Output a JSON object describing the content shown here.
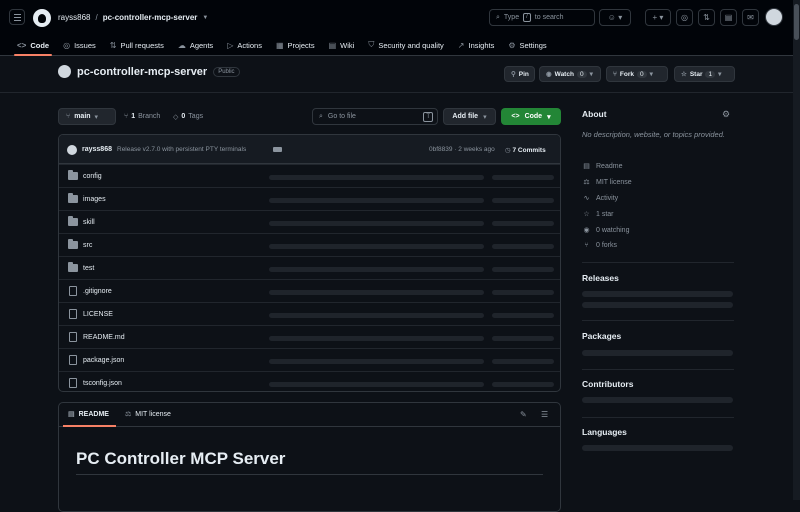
{
  "header": {
    "owner": "rayss868",
    "separator": "/",
    "repo": "pc-controller-mcp-server",
    "search_prefix": "Type",
    "search_key": "/",
    "search_suffix": "to search"
  },
  "tabs": [
    {
      "label": "Code",
      "icon": "<>"
    },
    {
      "label": "Issues",
      "icon": "◎"
    },
    {
      "label": "Pull requests",
      "icon": "⇅"
    },
    {
      "label": "Agents",
      "icon": "☁"
    },
    {
      "label": "Actions",
      "icon": "▷"
    },
    {
      "label": "Projects",
      "icon": "▦"
    },
    {
      "label": "Wiki",
      "icon": "▤"
    },
    {
      "label": "Security and quality",
      "icon": "⛉"
    },
    {
      "label": "Insights",
      "icon": "↗"
    },
    {
      "label": "Settings",
      "icon": "⚙"
    }
  ],
  "repo_header": {
    "name": "pc-controller-mcp-server",
    "visibility": "Public",
    "pin_label": "Pin",
    "watch_label": "Watch",
    "watch_count": "0",
    "fork_label": "Fork",
    "fork_count": "0",
    "star_label": "Star",
    "star_count": "1"
  },
  "toolbar": {
    "branch": "main",
    "branch_count": "1",
    "branch_label": "Branch",
    "tag_count": "0",
    "tag_label": "Tags",
    "go_to_file_placeholder": "Go to file",
    "go_to_file_key": "T",
    "add_file_label": "Add file",
    "code_label": "Code"
  },
  "commit": {
    "author": "rayss868",
    "message": "Release v2.7.0 with persistent PTY terminals",
    "hash_time": "0bf8839 · 2 weeks ago",
    "commit_count": "7 Commits"
  },
  "files": [
    {
      "name": "config",
      "type": "dir"
    },
    {
      "name": "images",
      "type": "dir"
    },
    {
      "name": "skill",
      "type": "dir"
    },
    {
      "name": "src",
      "type": "dir"
    },
    {
      "name": "test",
      "type": "dir"
    },
    {
      "name": ".gitignore",
      "type": "file"
    },
    {
      "name": "LICENSE",
      "type": "file"
    },
    {
      "name": "README.md",
      "type": "file"
    },
    {
      "name": "package.json",
      "type": "file"
    },
    {
      "name": "tsconfig.json",
      "type": "file"
    }
  ],
  "readme": {
    "tab_readme": "README",
    "tab_license": "MIT license",
    "heading": "PC Controller MCP Server"
  },
  "about": {
    "title": "About",
    "description": "No description, website, or topics provided.",
    "links": [
      {
        "label": "Readme",
        "icon": "book-icon"
      },
      {
        "label": "MIT license",
        "icon": "scale-icon"
      },
      {
        "label": "Activity",
        "icon": "pulse-icon"
      },
      {
        "label": "1 star",
        "icon": "star-icon"
      },
      {
        "label": "0 watching",
        "icon": "eye-icon"
      },
      {
        "label": "0 forks",
        "icon": "fork-icon"
      }
    ]
  },
  "sidebar_sections": {
    "releases": "Releases",
    "packages": "Packages",
    "contributors": "Contributors",
    "languages": "Languages"
  },
  "colors": {
    "accent_tab": "#f78166",
    "code_button": "#238636",
    "background": "#0d1117"
  }
}
